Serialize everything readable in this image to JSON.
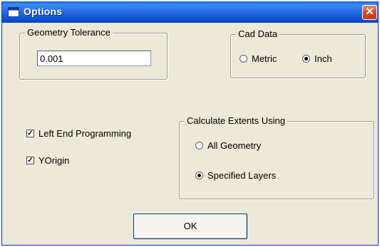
{
  "window": {
    "title": "Options",
    "close_glyph": "✕"
  },
  "geometry_tolerance": {
    "label": "Geometry Tolerance",
    "value": "0.001"
  },
  "cad_data": {
    "label": "Cad Data",
    "options": [
      {
        "label": "Metric",
        "selected": false
      },
      {
        "label": "Inch",
        "selected": true
      }
    ]
  },
  "checkboxes": [
    {
      "label": "Left End Programming",
      "checked": true
    },
    {
      "label": "YOrigin",
      "checked": true
    }
  ],
  "calculate_extents": {
    "label": "Calculate Extents Using",
    "options": [
      {
        "label": "All Geometry",
        "selected": false
      },
      {
        "label": "Specified Layers",
        "selected": true
      }
    ]
  },
  "ok_button": {
    "label": "OK"
  }
}
